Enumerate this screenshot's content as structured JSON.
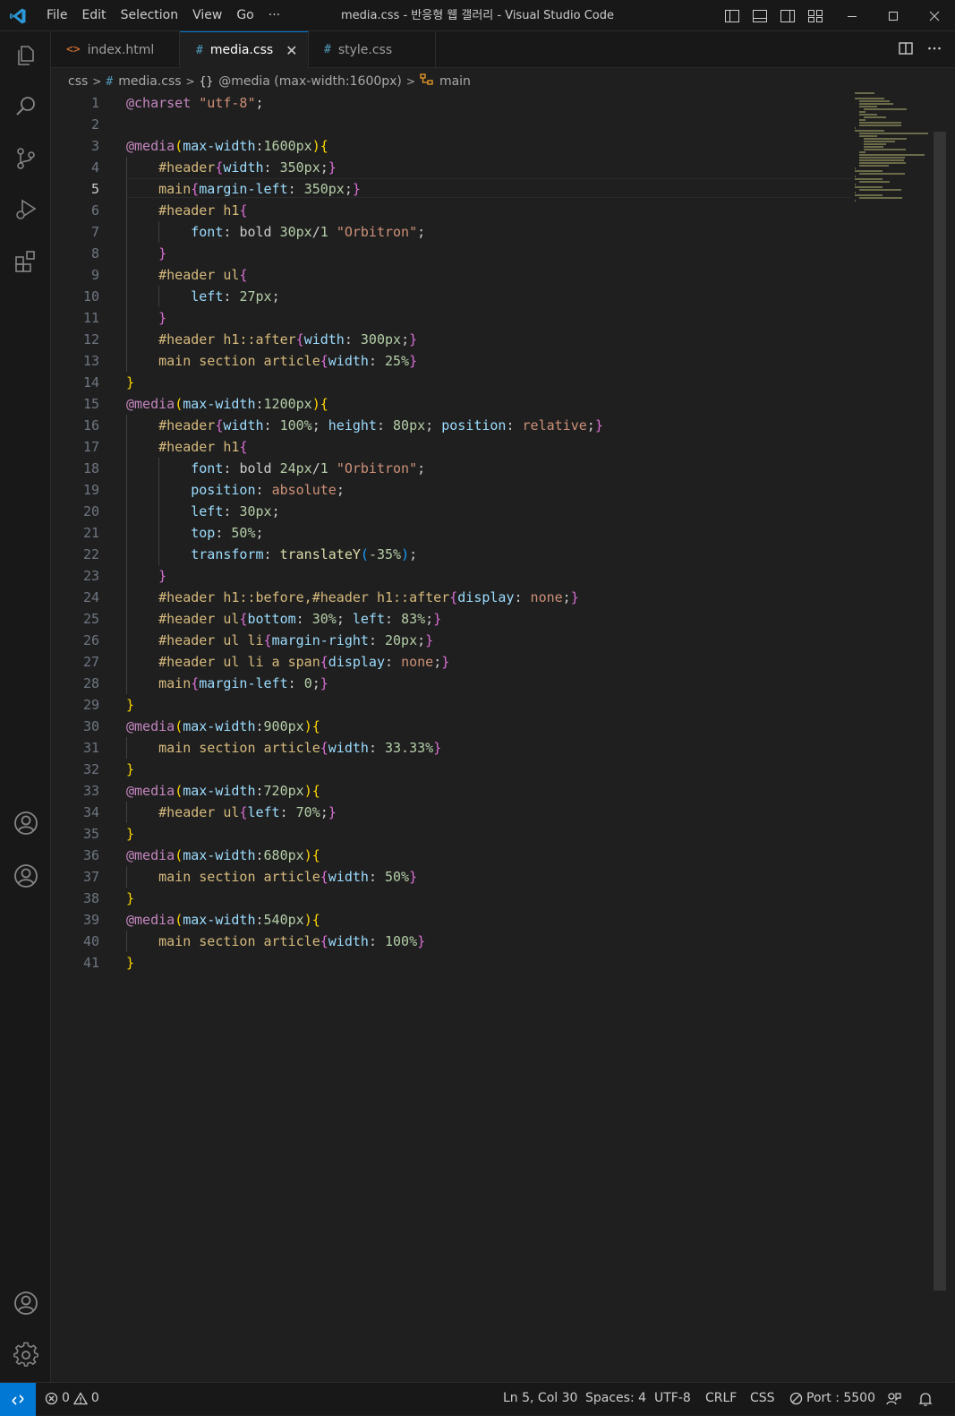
{
  "window": {
    "title": "media.css - 반응형 웹 갤러리 - Visual Studio Code",
    "menu": [
      "File",
      "Edit",
      "Selection",
      "View",
      "Go",
      "···"
    ]
  },
  "tabs": [
    {
      "label": "index.html",
      "icon": "html-file-icon"
    },
    {
      "label": "media.css",
      "icon": "css-file-icon",
      "active": true,
      "close": "✕"
    },
    {
      "label": "style.css",
      "icon": "css-file-icon"
    }
  ],
  "breadcrumb": {
    "folder": "css",
    "file": "media.css",
    "rule_icon": "{}",
    "rule": "@media (max-width:1600px)",
    "symbol": "main"
  },
  "editor": {
    "current_line": 5,
    "lines": [
      "@charset \"utf-8\";",
      "",
      "@media(max-width:1600px){",
      "    #header{width: 350px;}",
      "    main{margin-left: 350px;}",
      "    #header h1{",
      "        font: bold 30px/1 \"Orbitron\";",
      "    }",
      "    #header ul{",
      "        left: 27px;",
      "    }",
      "    #header h1::after{width: 300px;}",
      "    main section article{width: 25%}",
      "}",
      "@media(max-width:1200px){",
      "    #header{width: 100%; height: 80px; position: relative;}",
      "    #header h1{",
      "        font: bold 24px/1 \"Orbitron\";",
      "        position: absolute;",
      "        left: 30px;",
      "        top: 50%;",
      "        transform: translateY(-35%);",
      "    }",
      "    #header h1::before,#header h1::after{display: none;}",
      "    #header ul{bottom: 30%; left: 83%;}",
      "    #header ul li{margin-right: 20px;}",
      "    #header ul li a span{display: none;}",
      "    main{margin-left: 0;}",
      "}",
      "@media(max-width:900px){",
      "    main section article{width: 33.33%}",
      "}",
      "@media(max-width:720px){",
      "    #header ul{left: 70%;}",
      "}",
      "@media(max-width:680px){",
      "    main section article{width: 50%}",
      "}",
      "@media(max-width:540px){",
      "    main section article{width: 100%}",
      "}"
    ]
  },
  "statusbar": {
    "errors": "0",
    "warnings": "0",
    "position": "Ln 5, Col 30",
    "spaces": "Spaces: 4",
    "encoding": "UTF-8",
    "eol": "CRLF",
    "language": "CSS",
    "port": "Port : 5500"
  },
  "colors": {
    "accent": "#0078d4",
    "background": "#1f1f1f",
    "chrome": "#181818"
  }
}
